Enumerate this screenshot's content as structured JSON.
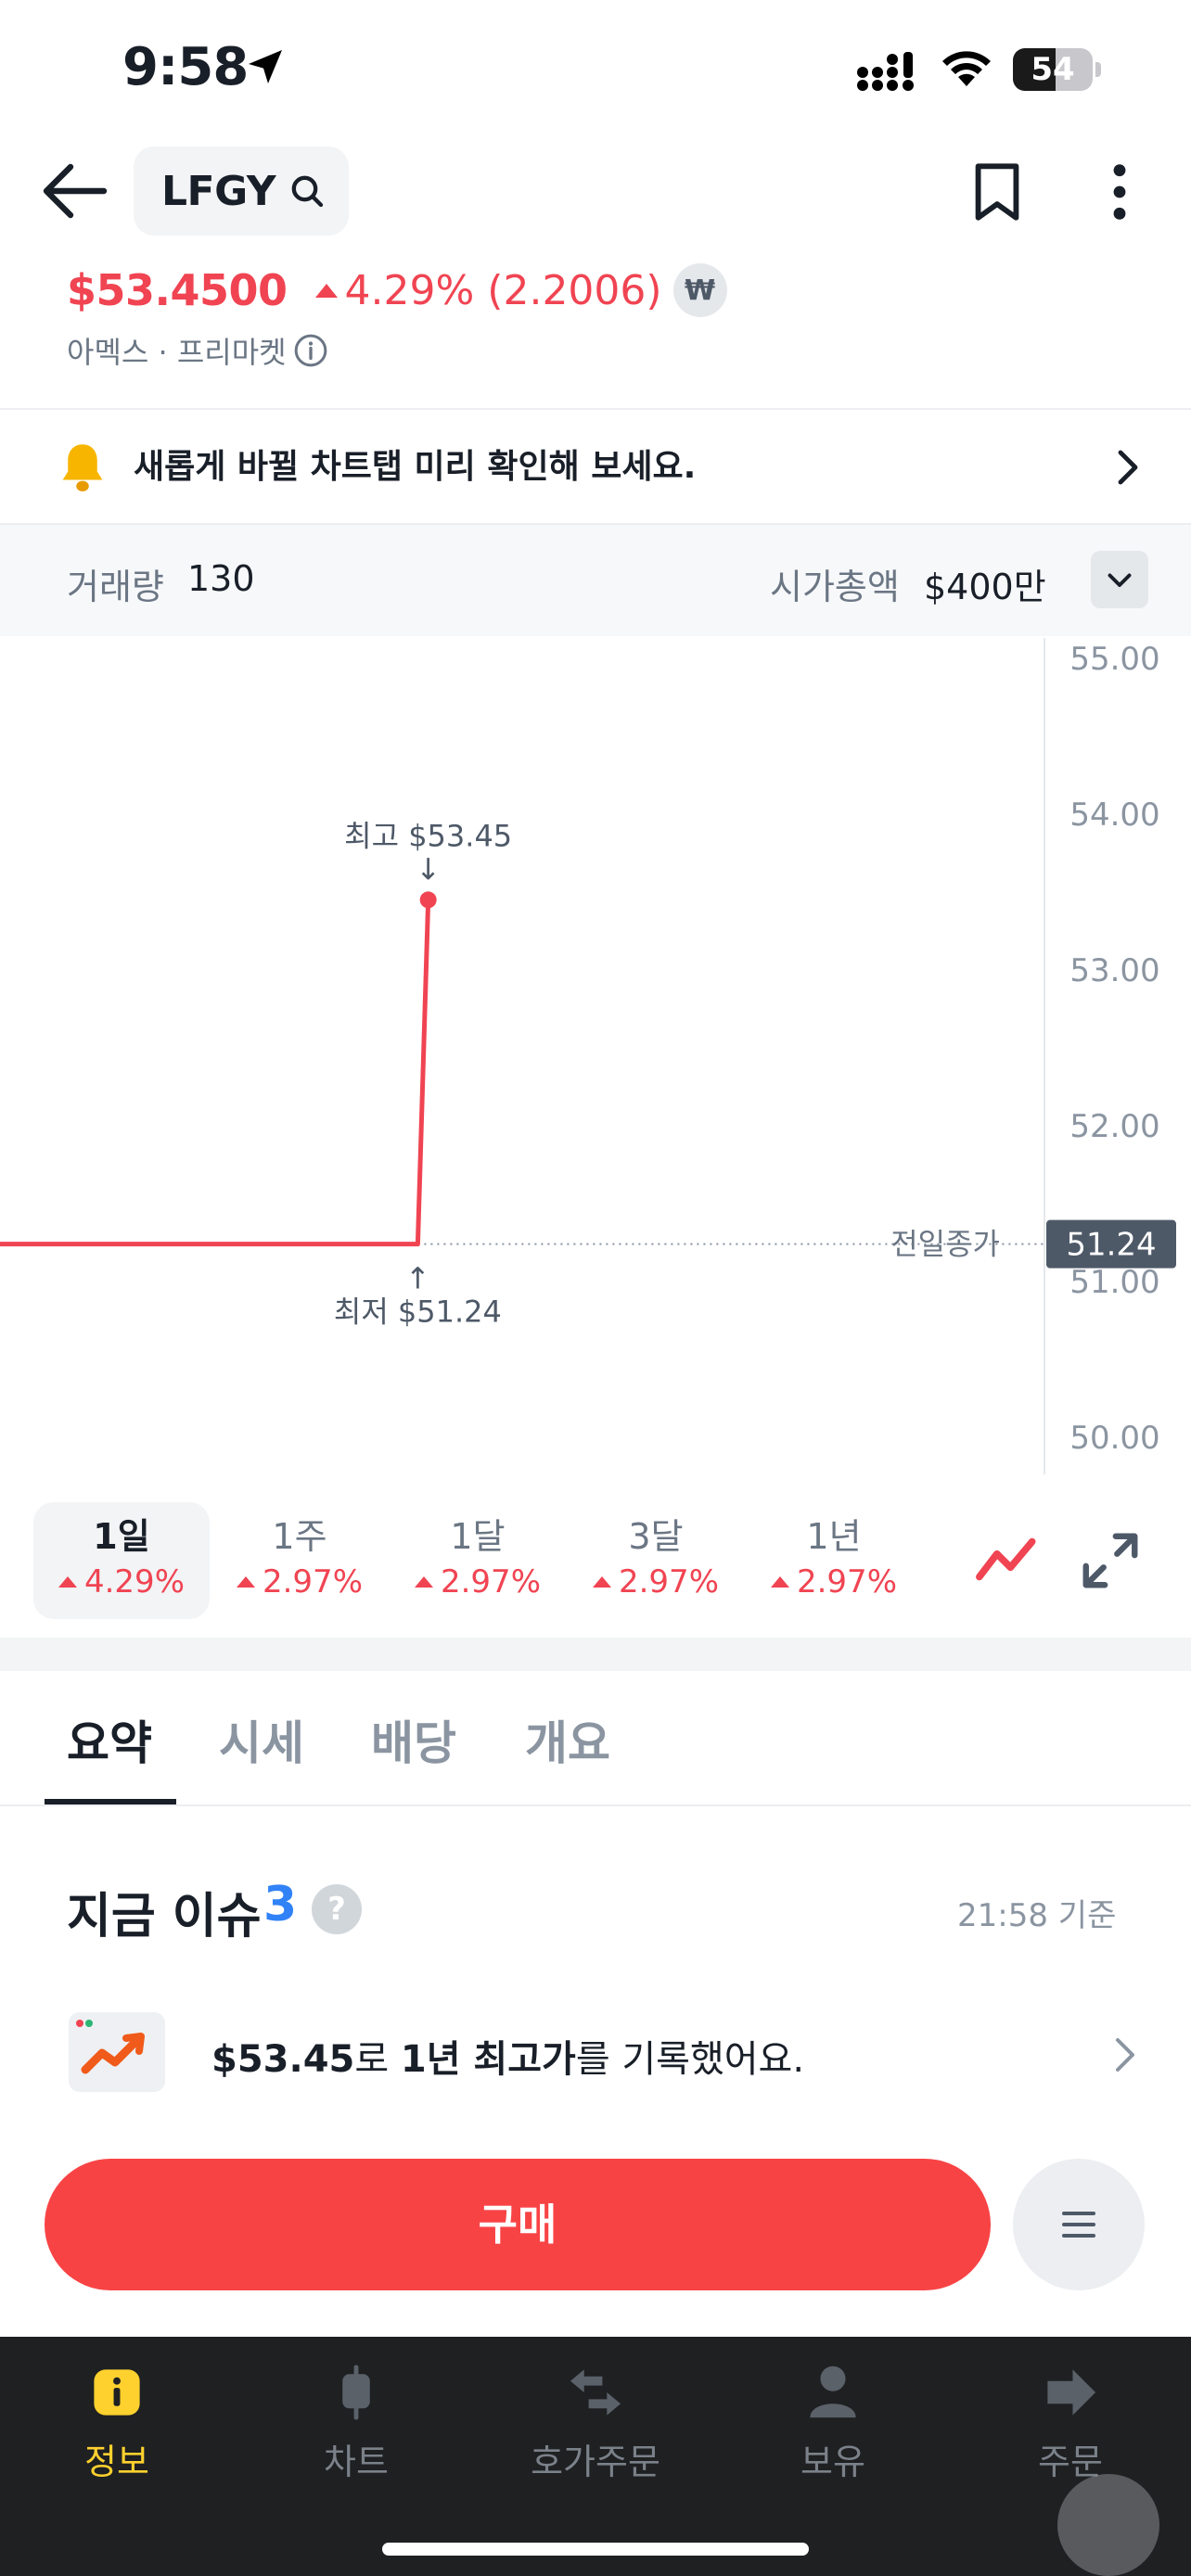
{
  "status_bar": {
    "time": "9:58",
    "battery": "54",
    "battery_level": 0.54
  },
  "header": {
    "ticker": "LFGY"
  },
  "quote": {
    "price": "$53.4500",
    "change": "4.29% (2.2006)",
    "currency_symbol": "₩",
    "market": "아멕스 · 프리마켓"
  },
  "notice": {
    "text": "새롭게 바뀔 차트탭 미리 확인해 보세요."
  },
  "stats": {
    "volume_label": "거래량",
    "volume_value": "130",
    "cap_label": "시가총액",
    "cap_value": "$400만"
  },
  "chart_data": {
    "type": "line",
    "y_ticks": [
      "55.00",
      "54.00",
      "53.00",
      "52.00",
      "51.00",
      "50.00"
    ],
    "ylim": [
      50.0,
      55.0
    ],
    "series": [
      {
        "points": [
          [
            0,
            51.24
          ],
          [
            0.4,
            51.24
          ],
          [
            0.41,
            53.45
          ]
        ]
      }
    ],
    "high_label": "최고 $53.45",
    "low_label": "최저 $51.24",
    "prev_close_label": "전일종가",
    "prev_close_value": "51.24",
    "up_arrow": "↑",
    "down_arrow": "↓",
    "color": "#f04452"
  },
  "periods": [
    {
      "label": "1일",
      "change": "4.29%"
    },
    {
      "label": "1주",
      "change": "2.97%"
    },
    {
      "label": "1달",
      "change": "2.97%"
    },
    {
      "label": "3달",
      "change": "2.97%"
    },
    {
      "label": "1년",
      "change": "2.97%"
    }
  ],
  "tabs": [
    "요약",
    "시세",
    "배당",
    "개요"
  ],
  "issues": {
    "title": "지금 이슈",
    "count": "3",
    "help": "?",
    "time": "21:58 기준",
    "item_price": "$53.45",
    "item_mid": "로 ",
    "item_bold": "1년 최고가",
    "item_tail": "를 기록했어요."
  },
  "actions": {
    "buy": "구매"
  },
  "bottom_nav": [
    "정보",
    "차트",
    "호가주문",
    "보유",
    "주문"
  ],
  "colors": {
    "up": "#f04452",
    "buy": "#f84345",
    "nav_active": "#ffd12e",
    "accent_blue": "#3182f6"
  }
}
